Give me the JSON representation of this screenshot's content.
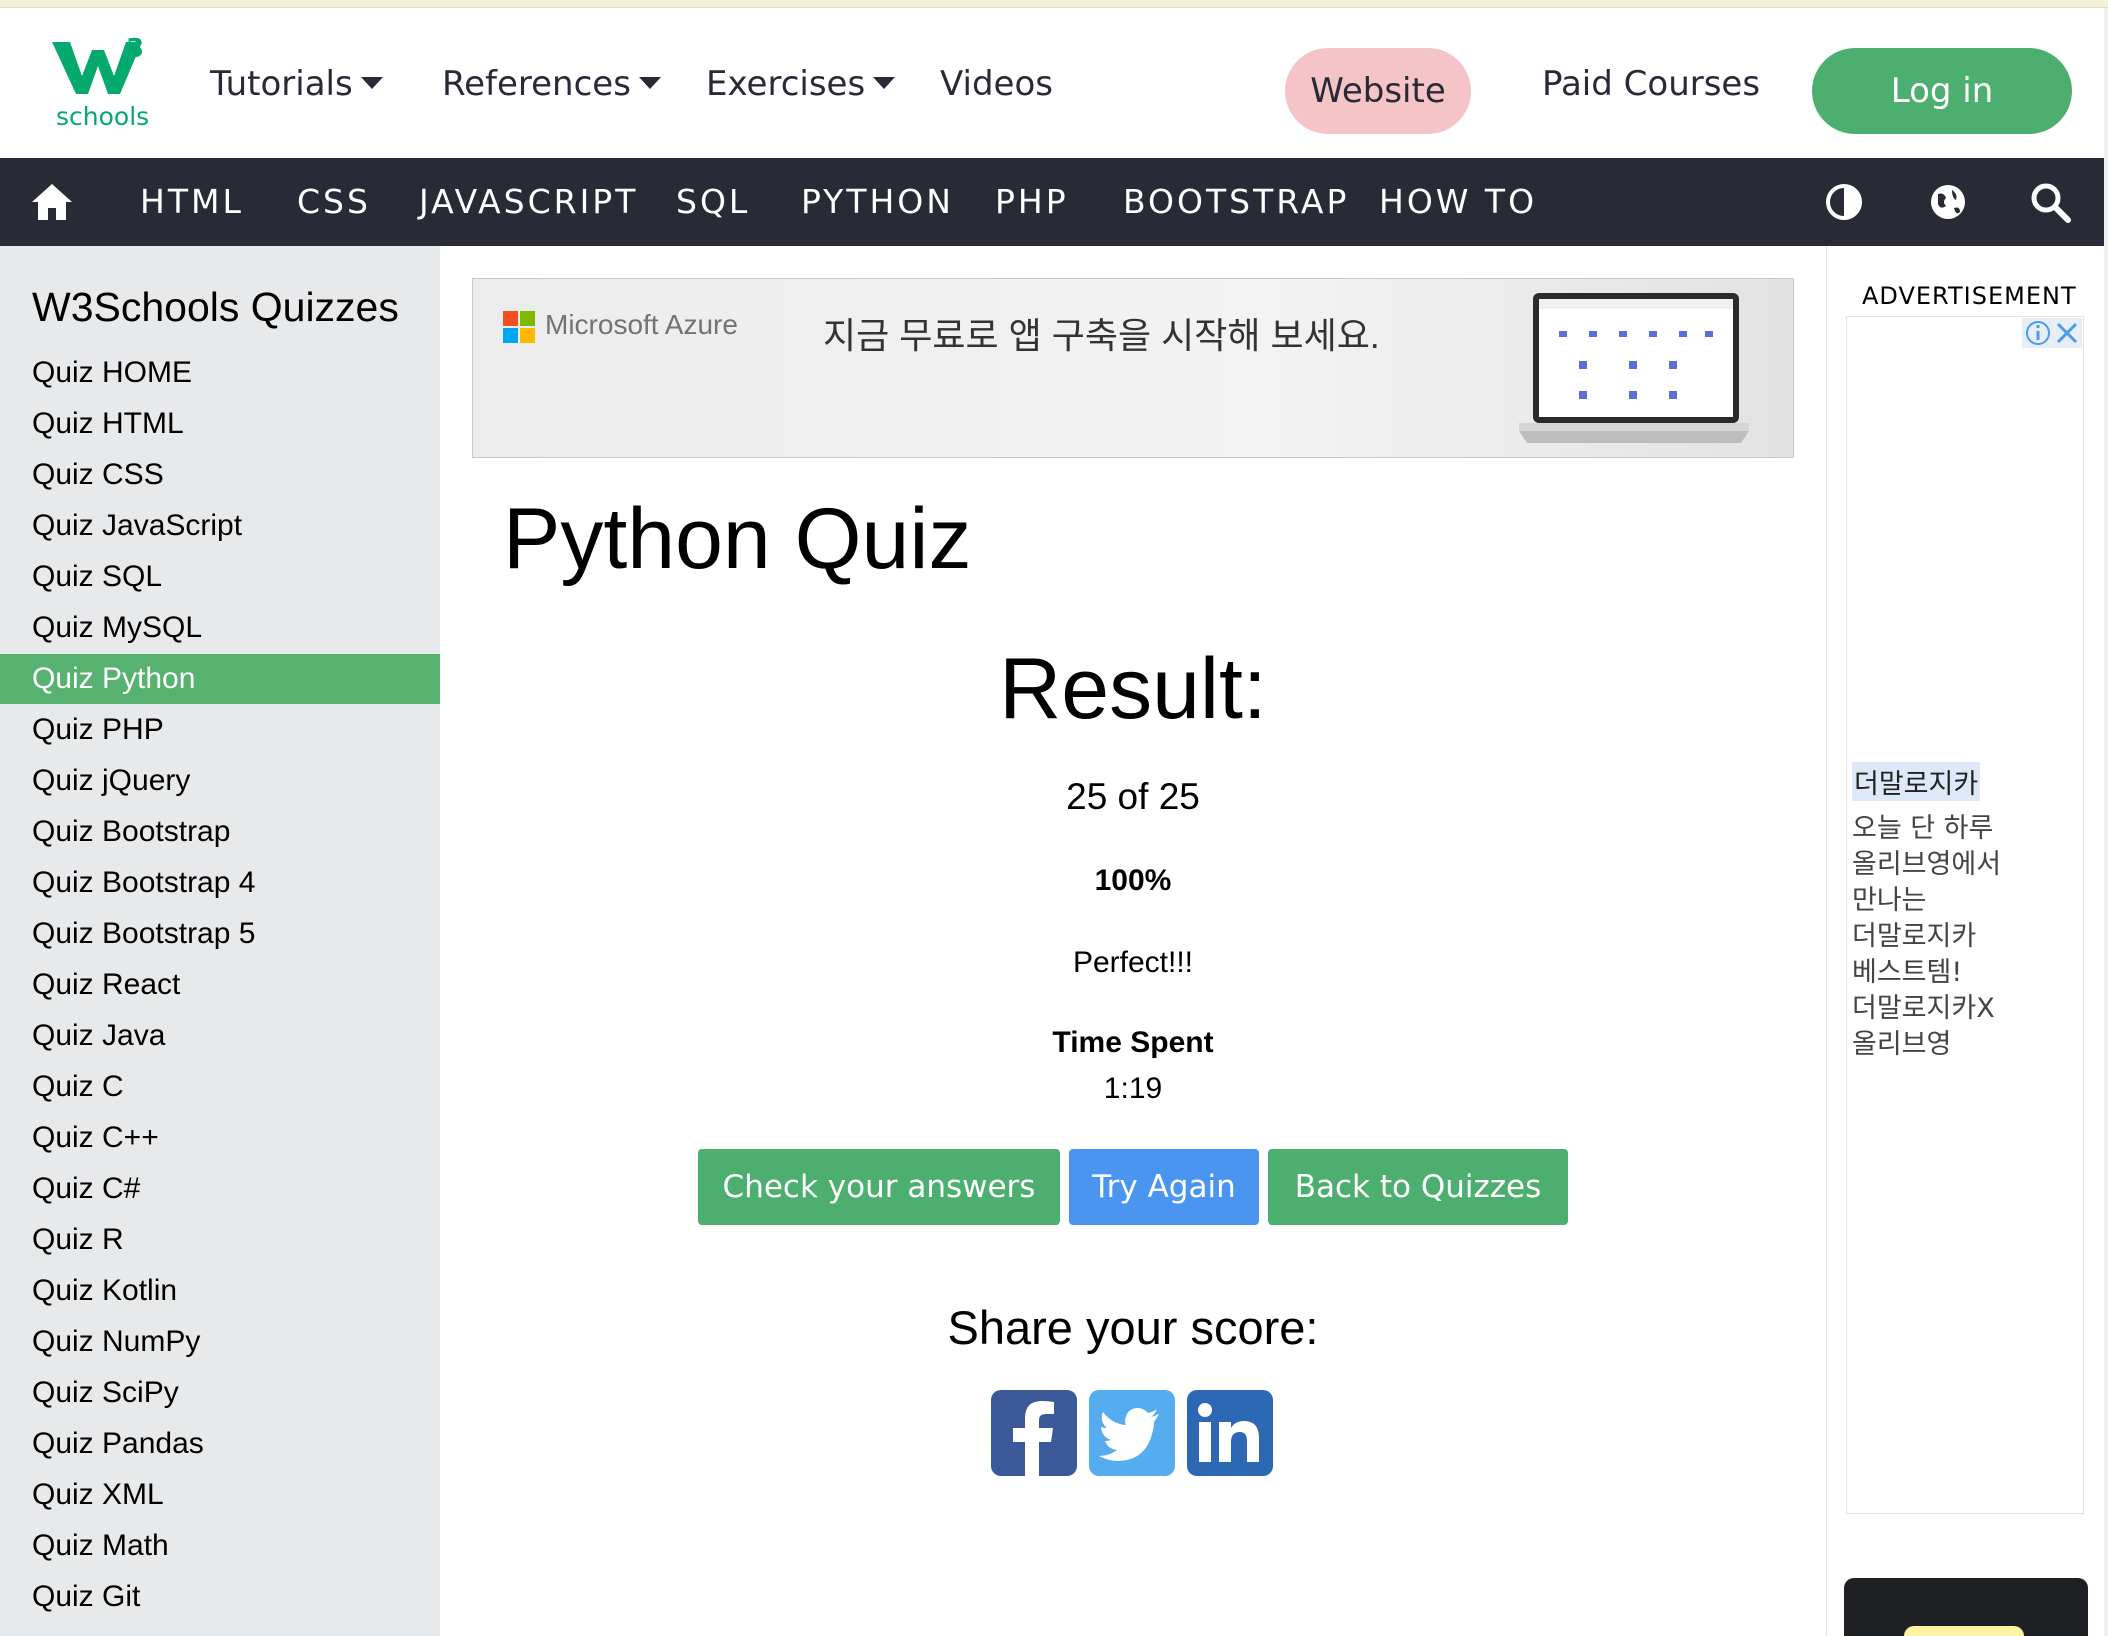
{
  "logo": {
    "brand": "W",
    "superscript": "3",
    "word": "schools"
  },
  "topnav": {
    "tutorials": "Tutorials",
    "references": "References",
    "exercises": "Exercises",
    "videos": "Videos",
    "website": "Website",
    "paid_courses": "Paid Courses",
    "login": "Log in"
  },
  "darknav": {
    "items": [
      "HTML",
      "CSS",
      "JAVASCRIPT",
      "SQL",
      "PYTHON",
      "PHP",
      "BOOTSTRAP",
      "HOW TO"
    ],
    "icons": [
      "home-icon",
      "contrast-icon",
      "globe-icon",
      "search-icon"
    ]
  },
  "sidebar": {
    "title": "W3Schools Quizzes",
    "active_index": 6,
    "items": [
      "Quiz HOME",
      "Quiz HTML",
      "Quiz CSS",
      "Quiz JavaScript",
      "Quiz SQL",
      "Quiz MySQL",
      "Quiz Python",
      "Quiz PHP",
      "Quiz jQuery",
      "Quiz Bootstrap",
      "Quiz Bootstrap 4",
      "Quiz Bootstrap 5",
      "Quiz React",
      "Quiz Java",
      "Quiz C",
      "Quiz C++",
      "Quiz C#",
      "Quiz R",
      "Quiz Kotlin",
      "Quiz NumPy",
      "Quiz SciPy",
      "Quiz Pandas",
      "Quiz XML",
      "Quiz Math",
      "Quiz Git"
    ]
  },
  "banner": {
    "brand": "Microsoft Azure",
    "headline": "지금 무료로 앱 구축을 시작해 보세요."
  },
  "main": {
    "title": "Python Quiz",
    "result_heading": "Result:",
    "score": "25 of 25",
    "percent": "100%",
    "verdict": "Perfect!!!",
    "time_label": "Time Spent",
    "time_value": "1:19",
    "buttons": {
      "check": "Check your answers",
      "try_again": "Try Again",
      "back": "Back to Quizzes"
    },
    "share_heading": "Share your score:"
  },
  "right_ad": {
    "label": "ADVERTISEMENT",
    "brand": "더말로지카",
    "lines": [
      "오늘 단 하루",
      "올리브영에서",
      "만나는",
      "더말로지카",
      "베스트템!",
      "더말로지카X",
      "올리브영"
    ]
  },
  "colors": {
    "accent_green": "#04AA6D",
    "button_green": "#4CAF6F",
    "button_blue": "#4A95F0",
    "nav_dark": "#282A35",
    "website_pink": "#F5C4C7",
    "facebook": "#3B5998",
    "twitter": "#55ACEE",
    "linkedin": "#2D68B5"
  }
}
